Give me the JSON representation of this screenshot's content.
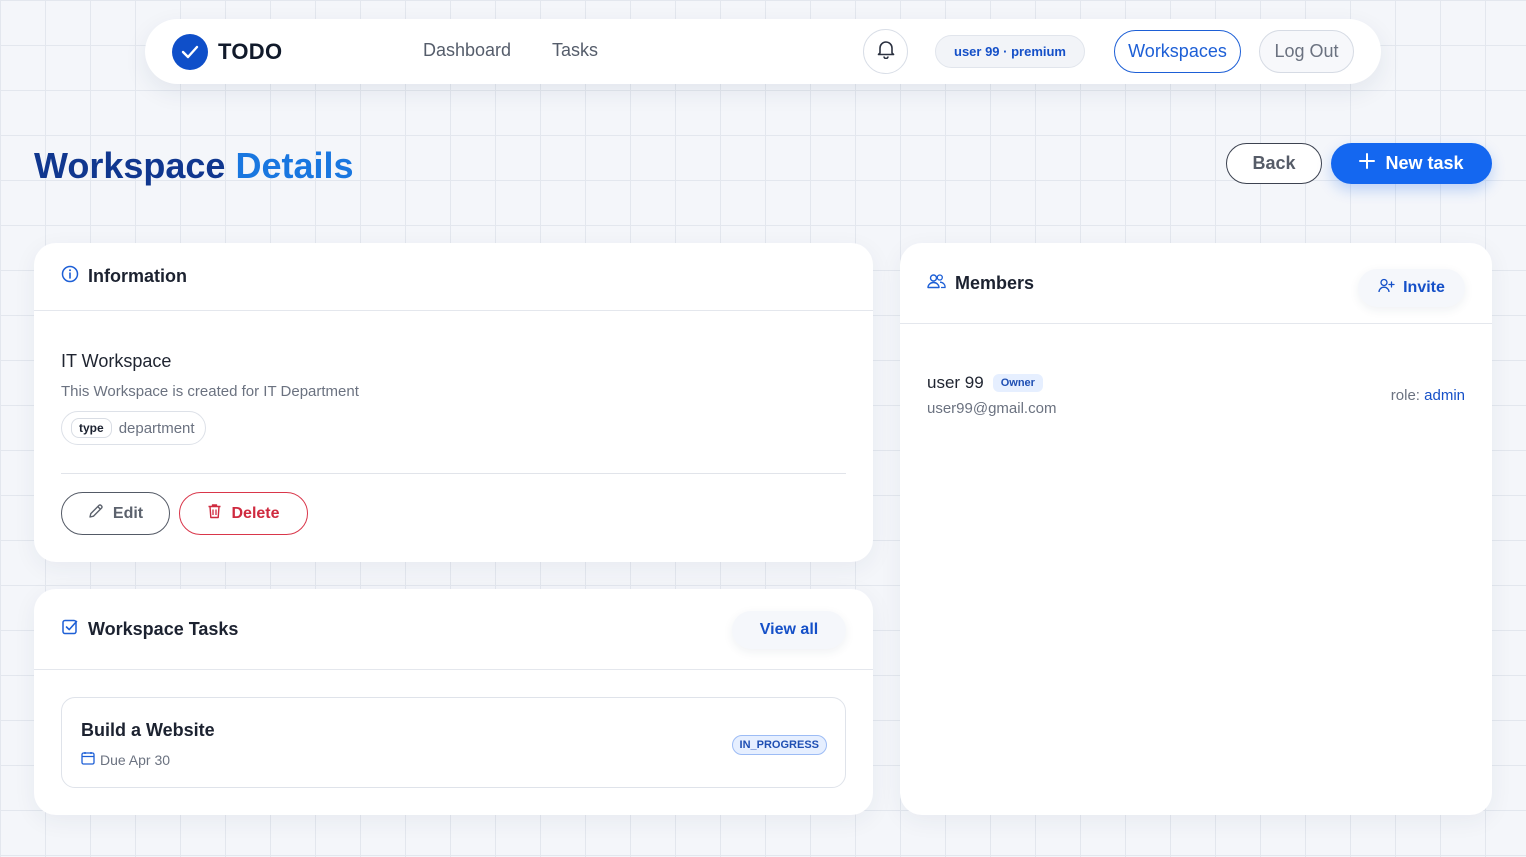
{
  "navbar": {
    "brand": "TODO",
    "links": [
      "Dashboard",
      "Tasks"
    ],
    "user_pill": "user 99 · premium",
    "workspaces_label": "Workspaces",
    "logout_label": "Log Out"
  },
  "header": {
    "title_part1": "Workspace",
    "title_part2": "Details",
    "back_label": "Back",
    "new_task_label": "New task"
  },
  "information": {
    "title": "Information",
    "workspace_name": "IT Workspace",
    "description": "This Workspace is created for IT Department",
    "type_key": "type",
    "type_value": "department",
    "edit_label": "Edit",
    "delete_label": "Delete"
  },
  "tasks": {
    "title": "Workspace Tasks",
    "view_all_label": "View all",
    "items": [
      {
        "title": "Build a Website",
        "due": "Due Apr 30",
        "status": "IN_PROGRESS"
      }
    ]
  },
  "members": {
    "title": "Members",
    "invite_label": "Invite",
    "items": [
      {
        "name": "user 99",
        "badge": "Owner",
        "email": "user99@gmail.com",
        "role_label": "role:",
        "role": "admin"
      }
    ]
  },
  "colors": {
    "primary": "#1467f0",
    "brand_dark": "#10378f",
    "title_accent": "#1977e0",
    "danger": "#cf2a3f",
    "link_blue": "#1550c8"
  },
  "icons": {
    "brand": "check-circle-icon",
    "notifications": "bell-icon",
    "new_task": "plus-icon",
    "information": "info-circle-icon",
    "edit": "pencil-icon",
    "delete": "trash-icon",
    "tasks": "checkbox-icon",
    "due": "calendar-icon",
    "members": "users-icon",
    "invite": "user-plus-icon"
  }
}
